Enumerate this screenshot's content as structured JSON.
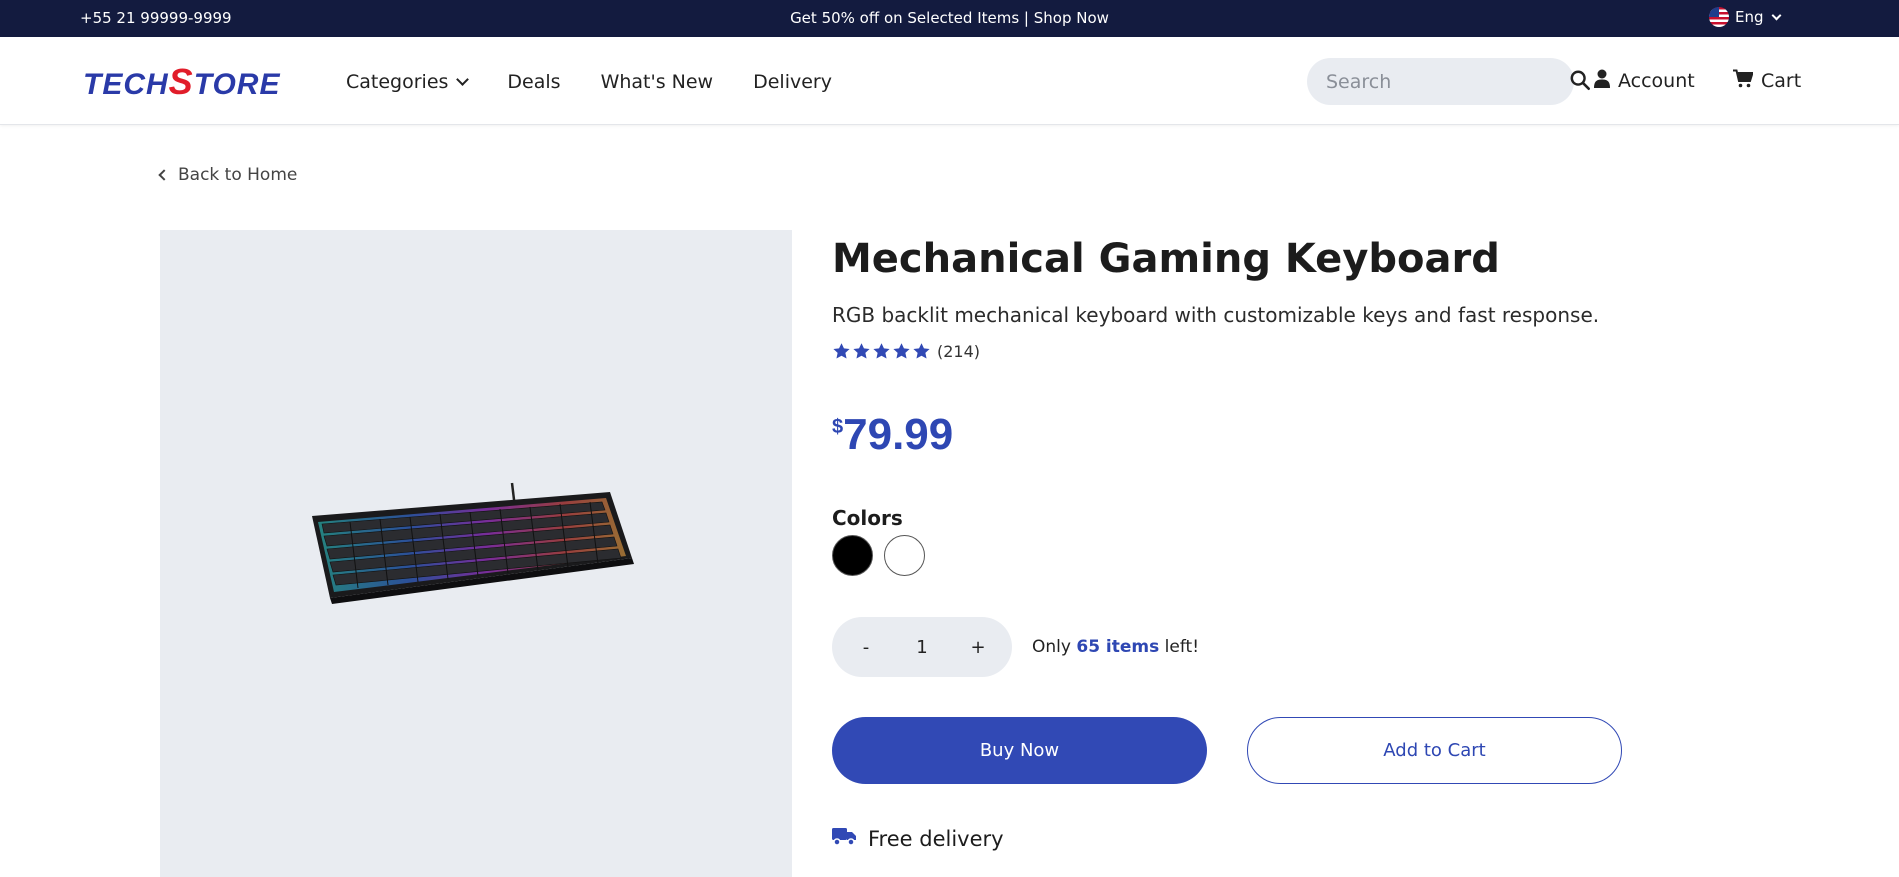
{
  "topbar": {
    "phone": "+55 21 99999-9999",
    "promo": "Get 50% off on Selected Items | Shop Now",
    "language": "Eng"
  },
  "header": {
    "logo_part1": "TECH",
    "logo_s": "S",
    "logo_part2": "TORE",
    "nav": {
      "categories": "Categories",
      "deals": "Deals",
      "whats_new": "What's New",
      "delivery": "Delivery"
    },
    "search_placeholder": "Search",
    "account": "Account",
    "cart": "Cart"
  },
  "breadcrumb": {
    "back": "Back to Home"
  },
  "product": {
    "title": "Mechanical Gaming Keyboard",
    "description": "RGB backlit mechanical keyboard with customizable keys and fast response.",
    "rating_stars": 5,
    "rating_count": "(214)",
    "currency": "$",
    "price": "79.99",
    "colors_label": "Colors",
    "colors": [
      "#000000",
      "#ffffff"
    ],
    "quantity": "1",
    "qty_minus": "-",
    "qty_plus": "+",
    "stock_prefix": "Only",
    "stock_count": "65 items",
    "stock_suffix": "left!",
    "buy_now": "Buy Now",
    "add_to_cart": "Add to Cart",
    "delivery": "Free delivery"
  },
  "theme": {
    "accent": "#3149b5",
    "topbar_bg": "#131b3f",
    "panel_bg": "#e9ecf1"
  }
}
